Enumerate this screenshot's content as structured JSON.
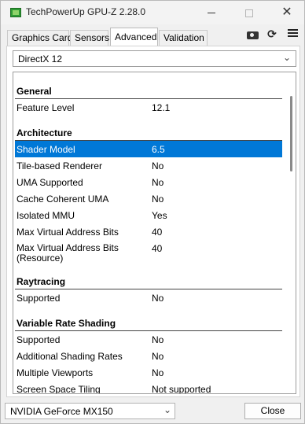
{
  "window": {
    "title": "TechPowerUp GPU-Z 2.28.0",
    "minimize_label": "",
    "maximize_label": "",
    "close_label": "✕"
  },
  "tabs": [
    {
      "label": "Graphics Card"
    },
    {
      "label": "Sensors"
    },
    {
      "label": "Advanced",
      "active": true
    },
    {
      "label": "Validation"
    }
  ],
  "toolbar_icons": [
    "camera-icon",
    "refresh-icon",
    "menu-icon"
  ],
  "api_select": {
    "value": "DirectX 12"
  },
  "properties": [
    {
      "type": "section",
      "label": "General"
    },
    {
      "type": "row",
      "label": "Feature Level",
      "value": "12.1"
    },
    {
      "type": "section",
      "label": "Architecture"
    },
    {
      "type": "row",
      "label": "Shader Model",
      "value": "6.5",
      "selected": true
    },
    {
      "type": "row",
      "label": "Tile-based Renderer",
      "value": "No"
    },
    {
      "type": "row",
      "label": "UMA Supported",
      "value": "No"
    },
    {
      "type": "row",
      "label": "Cache Coherent UMA",
      "value": "No"
    },
    {
      "type": "row",
      "label": "Isolated MMU",
      "value": "Yes"
    },
    {
      "type": "row",
      "label": "Max Virtual Address Bits",
      "value": "40"
    },
    {
      "type": "tall",
      "label": "Max Virtual Address Bits\n(Resource)",
      "value": "40"
    },
    {
      "type": "section",
      "label": "Raytracing"
    },
    {
      "type": "row",
      "label": "Supported",
      "value": "No"
    },
    {
      "type": "section",
      "label": "Variable Rate Shading"
    },
    {
      "type": "row",
      "label": "Supported",
      "value": "No"
    },
    {
      "type": "row",
      "label": "Additional Shading Rates",
      "value": "No"
    },
    {
      "type": "row",
      "label": "Multiple Viewports",
      "value": "No"
    },
    {
      "type": "row",
      "label": "Screen Space Tiling",
      "value": "Not supported"
    }
  ],
  "gpu_select": {
    "value": "NVIDIA GeForce MX150"
  },
  "close_button": {
    "label": "Close"
  },
  "colors": {
    "selection": "#0078d7",
    "app_icon": "#2f9b35"
  }
}
